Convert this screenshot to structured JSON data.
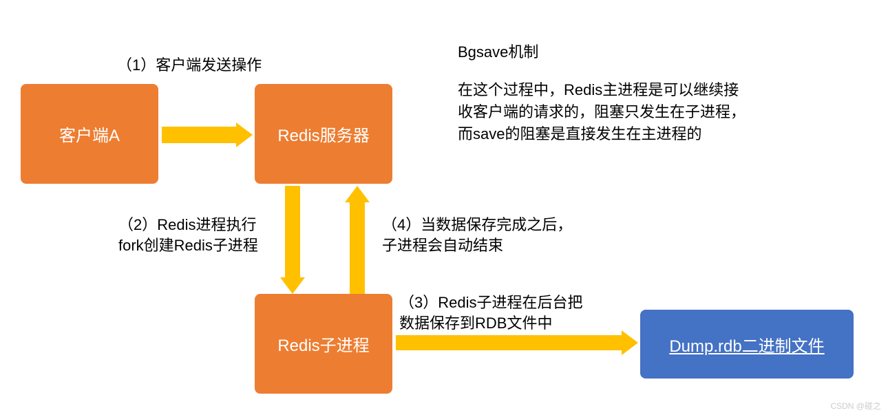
{
  "nodes": {
    "client_a": "客户端A",
    "redis_server": "Redis服务器",
    "redis_child": "Redis子进程",
    "dump_rdb": "Dump.rdb二进制文件"
  },
  "labels": {
    "step1": "（1）客户端发送操作",
    "step2": "（2）Redis进程执行\nfork创建Redis子进程",
    "step3": "（3）Redis子进程在后台把\n数据保存到RDB文件中",
    "step4": "（4）当数据保存完成之后，\n子进程会自动结束"
  },
  "text": {
    "title": "Bgsave机制",
    "description": "在这个过程中，Redis主进程是可以继续接收客户端的请求的，阻塞只发生在子进程，而save的阻塞是直接发生在主进程的",
    "watermark": "CSDN @碰之"
  },
  "chart_data": {
    "type": "diagram",
    "title": "Bgsave机制",
    "nodes": [
      {
        "id": "client_a",
        "label": "客户端A",
        "color": "#ED7D31"
      },
      {
        "id": "redis_server",
        "label": "Redis服务器",
        "color": "#ED7D31"
      },
      {
        "id": "redis_child",
        "label": "Redis子进程",
        "color": "#ED7D31"
      },
      {
        "id": "dump_rdb",
        "label": "Dump.rdb二进制文件",
        "color": "#4472C4"
      }
    ],
    "edges": [
      {
        "from": "client_a",
        "to": "redis_server",
        "label": "（1）客户端发送操作"
      },
      {
        "from": "redis_server",
        "to": "redis_child",
        "label": "（2）Redis进程执行fork创建Redis子进程"
      },
      {
        "from": "redis_child",
        "to": "dump_rdb",
        "label": "（3）Redis子进程在后台把数据保存到RDB文件中"
      },
      {
        "from": "redis_child",
        "to": "redis_server",
        "label": "（4）当数据保存完成之后，子进程会自动结束"
      }
    ],
    "annotation": "在这个过程中，Redis主进程是可以继续接收客户端的请求的，阻塞只发生在子进程，而save的阻塞是直接发生在主进程的"
  }
}
